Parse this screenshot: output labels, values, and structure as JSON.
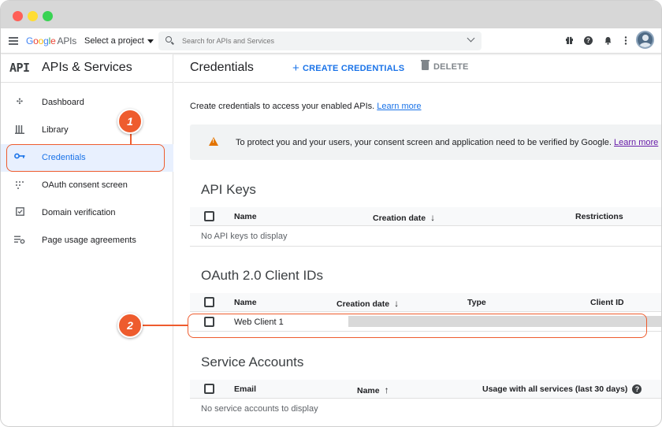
{
  "topbar": {
    "logo_text": [
      "G",
      "o",
      "o",
      "g",
      "l",
      "e"
    ],
    "logo_suffix": "APIs",
    "project_label": "Select a project",
    "search_placeholder": "Search for APIs and Services",
    "icons": [
      "menu-icon",
      "search-icon",
      "chevron-down-icon",
      "gift-icon",
      "help-icon",
      "bell-icon",
      "more-vert-icon",
      "avatar"
    ]
  },
  "sidebar": {
    "logo": "API",
    "title": "APIs & Services",
    "items": [
      {
        "label": "Dashboard",
        "icon": "dashboard-icon",
        "active": false
      },
      {
        "label": "Library",
        "icon": "library-icon",
        "active": false
      },
      {
        "label": "Credentials",
        "icon": "key-icon",
        "active": true
      },
      {
        "label": "OAuth consent screen",
        "icon": "consent-icon",
        "active": false
      },
      {
        "label": "Domain verification",
        "icon": "checkbox-icon",
        "active": false
      },
      {
        "label": "Page usage agreements",
        "icon": "settings-list-icon",
        "active": false
      }
    ]
  },
  "main": {
    "title": "Credentials",
    "create_label": "CREATE CREDENTIALS",
    "delete_label": "DELETE",
    "intro_text": "Create credentials to access your enabled APIs.",
    "intro_link": "Learn more",
    "banner_text": "To protect you and your users, your consent screen and application need to be verified by Google.",
    "banner_link": "Learn more"
  },
  "api_keys": {
    "title": "API Keys",
    "columns": [
      "Name",
      "Creation date",
      "Restrictions"
    ],
    "sort_arrow": "↓",
    "empty": "No API keys to display"
  },
  "oauth": {
    "title": "OAuth 2.0 Client IDs",
    "columns": [
      "Name",
      "Creation date",
      "Type",
      "Client ID"
    ],
    "sort_arrow": "↓",
    "rows": [
      {
        "name": "Web Client 1"
      }
    ]
  },
  "service_accounts": {
    "title": "Service Accounts",
    "columns": [
      "Email",
      "Name",
      "Usage with all services (last 30 days)"
    ],
    "sort_arrow": "↑",
    "empty": "No service accounts to display"
  },
  "callouts": [
    "1",
    "2"
  ],
  "colors": {
    "accent": "#1a73e8",
    "callout": "#ee5c2e",
    "warning": "#e37400",
    "active_bg": "#e8f0fe"
  }
}
